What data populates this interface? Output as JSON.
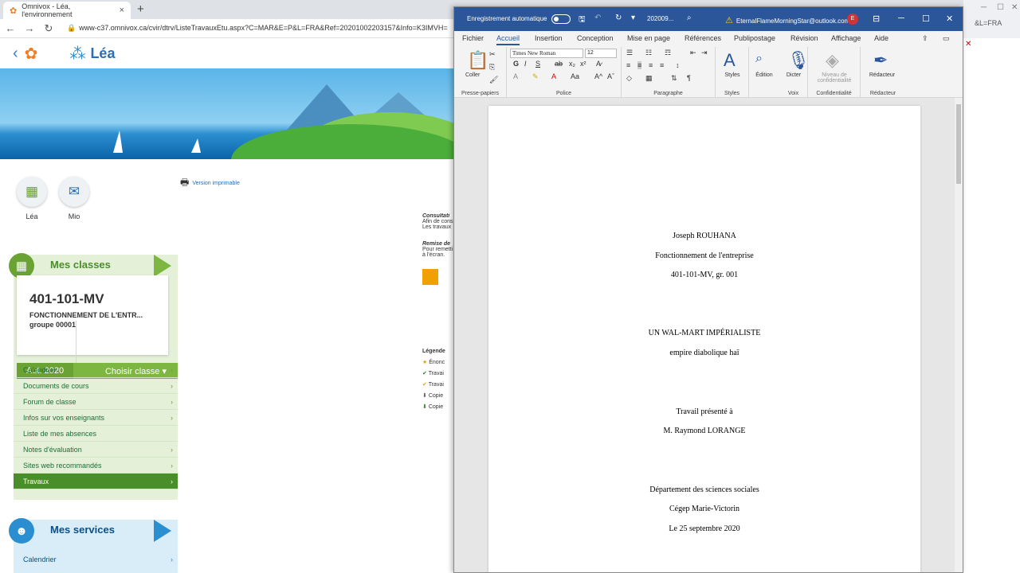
{
  "browser": {
    "tab_title": "Omnivox - Léa, l'environnement",
    "tab_close": "×",
    "new_tab": "+",
    "url": "www-c37.omnivox.ca/cvir/dtrv/ListeTravauxEtu.aspx?C=MAR&E=P&L=FRA&Ref=20201002203157&Info=K3IMVH="
  },
  "lea": {
    "title": "Léa",
    "top_icons": [
      {
        "label": "Léa",
        "icon": "grid-icon"
      },
      {
        "label": "Mio",
        "icon": "mail-icon"
      }
    ],
    "print_version": "Version imprimable",
    "classes_title": "Mes classes",
    "class_card": {
      "code": "401-101-MV",
      "name": "FONCTIONNEMENT DE L'ENTR...",
      "group": "groupe 00001"
    },
    "semester": "Aut. 2020",
    "choose_class": "Choisir classe",
    "menu": [
      {
        "label": "Calendrier"
      },
      {
        "label": "Documents de cours"
      },
      {
        "label": "Forum de classe"
      },
      {
        "label": "Infos sur vos enseignants"
      },
      {
        "label": "Liste de mes absences"
      },
      {
        "label": "Notes d'évaluation"
      },
      {
        "label": "Sites web recommandés"
      },
      {
        "label": "Travaux"
      }
    ],
    "services_title": "Mes services",
    "services_menu": [
      {
        "label": "Calendrier"
      }
    ],
    "consult": {
      "heading": "Consultati",
      "line1": "Afin de cons",
      "line2": "Les travaux",
      "heading2": "Remise de",
      "line3": "Pour remetti",
      "line4": "à l'écran.",
      "legend": "Légende",
      "legend_items": [
        "Énonc",
        "Travai",
        "Travai",
        "Copie",
        "Copie"
      ]
    }
  },
  "word": {
    "autosave": "Enregistrement automatique",
    "file_name": "202009...",
    "user": "EternalFlameMorningStar@outlook.com",
    "avatar": "E",
    "tabs": [
      "Fichier",
      "Accueil",
      "Insertion",
      "Conception",
      "Mise en page",
      "Références",
      "Publipostage",
      "Révision",
      "Affichage",
      "Aide"
    ],
    "font": "Times New Roman",
    "size": "12",
    "groups": {
      "clipboard": "Presse-papiers",
      "font": "Police",
      "paragraph": "Paragraphe",
      "styles": "Styles",
      "voice": "Voix",
      "confidentiality": "Confidentialité",
      "editor": "Rédacteur"
    },
    "buttons": {
      "paste": "Coller",
      "styles": "Styles",
      "editing": "Édition",
      "dictate": "Dicter",
      "sensitivity": "Niveau de confidentialité",
      "editor": "Rédacteur"
    },
    "document": {
      "author": "Joseph ROUHANA",
      "course": "Fonctionnement de l'entreprise",
      "group": "401-101-MV, gr. 001",
      "title": "UN WAL-MART IMPÉRIALISTE",
      "subtitle": "empire diabolique haï",
      "presented": "Travail présenté à",
      "teacher": "M. Raymond LORANGE",
      "department": "Département des sciences sociales",
      "college": "Cégep Marie-Victorin",
      "date": "Le 25 septembre 2020"
    }
  },
  "right_strip": {
    "text": "&L=FRA"
  }
}
